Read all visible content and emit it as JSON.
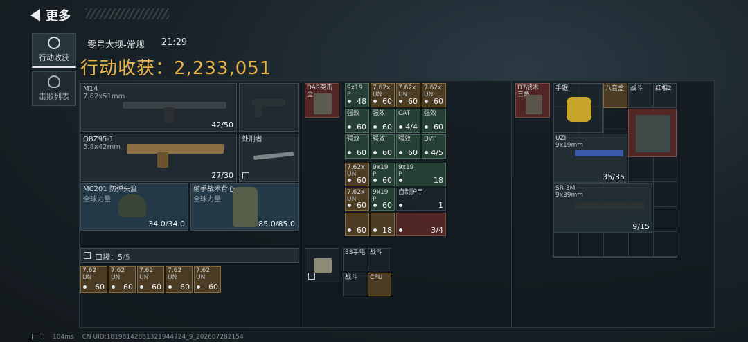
{
  "header": {
    "back_label": "更多"
  },
  "side_nav": [
    {
      "label": "行动收获"
    },
    {
      "label": "击败列表"
    }
  ],
  "raid": {
    "map": "零号大坝-常规",
    "time": "21:29"
  },
  "haul": {
    "label": "行动收获：",
    "value": "2,233,051"
  },
  "loadout": {
    "primary": {
      "name": "M14",
      "caliber": "7.62x51mm",
      "ammo": "42/50"
    },
    "secondary": {
      "name": "QBZ95-1",
      "caliber": "5.8x42mm",
      "ammo": "27/30"
    },
    "melee": {
      "name": "处刑者"
    },
    "helmet": {
      "name": "MC201 防弹头盔",
      "brand": "全球力量",
      "durability": "34.0/34.0"
    },
    "armor": {
      "name": "射手战术背心",
      "brand": "全球力量",
      "durability": "85.0/85.0"
    }
  },
  "pockets": {
    "label": "口袋：",
    "count": "5",
    "total": "/5",
    "items": [
      {
        "name": "7.62",
        "sub": "UN",
        "count": "60"
      },
      {
        "name": "7.62",
        "sub": "UN",
        "count": "60"
      },
      {
        "name": "7.62",
        "sub": "UN",
        "count": "60"
      },
      {
        "name": "7.62",
        "sub": "UN",
        "count": "60"
      },
      {
        "name": "7.62",
        "sub": "UN",
        "count": "60"
      }
    ]
  },
  "rig": {
    "name": "DAR突击",
    "sub": "全",
    "cells": [
      {
        "name": "9x19",
        "sub": "P",
        "count": "48",
        "kind": "green"
      },
      {
        "name": "7.62x",
        "sub": "UN",
        "count": "60",
        "kind": "gold"
      },
      {
        "name": "7.62x",
        "sub": "UN",
        "count": "60",
        "kind": "gold"
      },
      {
        "name": "7.62x",
        "sub": "UN",
        "count": "60",
        "kind": "gold"
      },
      {
        "name": "强效",
        "sub": "",
        "count": "60",
        "kind": "green"
      },
      {
        "name": "强效",
        "sub": "",
        "count": "60",
        "kind": "green"
      },
      {
        "name": "CAT",
        "sub": "",
        "count": "4/4",
        "kind": "green"
      },
      {
        "name": "强效",
        "sub": "",
        "count": "60",
        "kind": "green"
      },
      {
        "name": "强效",
        "sub": "",
        "count": "60",
        "kind": "green"
      },
      {
        "name": "强效",
        "sub": "",
        "count": "60",
        "kind": "green"
      },
      {
        "name": "强效",
        "sub": "",
        "count": "60",
        "kind": "green"
      },
      {
        "name": "DVF",
        "sub": "",
        "count": "4/5",
        "kind": "green"
      }
    ]
  },
  "bag_rows": [
    {
      "name": "7.62x",
      "sub": "UN",
      "count": "60",
      "kind": "gold"
    },
    {
      "name": "9x19",
      "sub": "P",
      "count": "60",
      "kind": "green"
    },
    {
      "name": "9x19",
      "sub": "P",
      "count": "18",
      "kind": "green"
    },
    {
      "name": "7.62x",
      "sub": "UN",
      "count": "60",
      "kind": "gold"
    },
    {
      "name": "9x19",
      "sub": "P",
      "count": "60",
      "kind": "green"
    },
    {
      "name": "自制护甲",
      "sub": "",
      "count": "1",
      "kind": "empty"
    },
    {
      "name": "",
      "sub": "",
      "count": "60",
      "kind": "gold"
    },
    {
      "name": "",
      "sub": "",
      "count": "18",
      "kind": "gold"
    },
    {
      "name": "",
      "sub": "",
      "count": "3/4",
      "kind": "red"
    }
  ],
  "safe": {
    "cells": [
      {
        "name": "3S手电",
        "kind": "empty"
      },
      {
        "name": "战斗",
        "kind": "empty"
      },
      {
        "name": "战斗",
        "kind": "empty"
      },
      {
        "name": "CPU",
        "kind": "gold"
      }
    ]
  },
  "backpack": {
    "name": "D7战术",
    "sub": "三角",
    "items": [
      {
        "name": "手锯",
        "kind": "empty"
      },
      {
        "name": "八音盒",
        "kind": "gold"
      },
      {
        "name": "战斗",
        "kind": "empty"
      },
      {
        "name": "红相2",
        "kind": "empty"
      },
      {
        "name": "UZI",
        "sub": "9x19mm",
        "count": "35/35"
      },
      {
        "name": "SR-3M",
        "sub": "9x39mm",
        "count": "9/15"
      }
    ]
  },
  "status": {
    "ping": "104ms",
    "uid": "CN UID:18198142881321944724_9_202607282154"
  }
}
